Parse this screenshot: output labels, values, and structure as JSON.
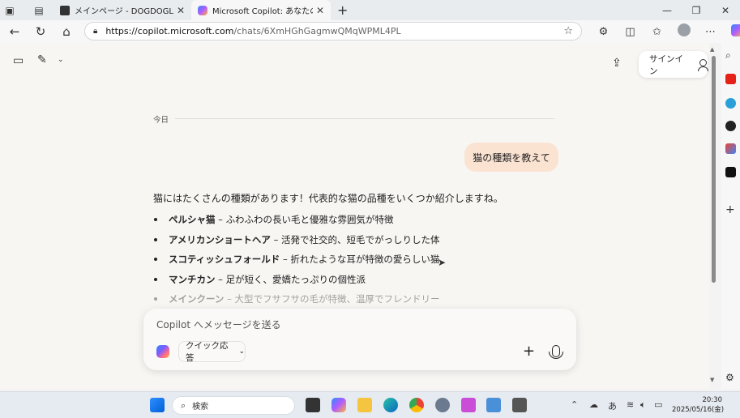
{
  "browser": {
    "tabs": [
      {
        "title": "メインページ - DOGDOGLAB",
        "active": false
      },
      {
        "title": "Microsoft Copilot: あなたの AI アシ",
        "active": true
      }
    ],
    "new_tab_symbol": "+",
    "url_host": "https://copilot.microsoft.com",
    "url_path": "/chats/6XmHGhGagmwQMqWPML4PL"
  },
  "page": {
    "signin_label": "サインイン",
    "today_label": "今日",
    "user_message": "猫の種類を教えて",
    "reply_intro": "猫にはたくさんの種類があります！代表的な猫の品種をいくつか紹介しますね。",
    "reply_items": [
      {
        "name": "ペルシャ猫",
        "sep": " – ",
        "desc": "ふわふわの長い毛と優雅な雰囲気が特徴"
      },
      {
        "name": "アメリカンショートヘア",
        "sep": " – ",
        "desc": "活発で社交的、短毛でがっしりした体"
      },
      {
        "name": "スコティッシュフォールド",
        "sep": " – ",
        "desc": "折れたような耳が特徴の愛らしい猫"
      },
      {
        "name": "マンチカン",
        "sep": " – ",
        "desc": "足が短く、愛嬌たっぷりの個性派"
      },
      {
        "name": "メインクーン",
        "sep": " – ",
        "desc": "大型でフサフサの毛が特徴、温厚でフレンドリー"
      }
    ],
    "composer_placeholder": "Copilot へメッセージを送る",
    "quick_response_label": "クイック応答"
  },
  "taskbar": {
    "search_label": "検索",
    "ime_label": "あ",
    "time": "20:30",
    "date": "2025/05/16(金)"
  },
  "colors": {
    "user_bubble": "#fbe3d2",
    "page_bg": "#f8f6f3",
    "edge_accent": "#0a66c2"
  },
  "icons": [
    "tab-actions-icon",
    "workspaces-icon",
    "back-icon",
    "refresh-icon",
    "home-icon",
    "lock-icon",
    "favorite-star-icon",
    "extensions-icon",
    "split-screen-icon",
    "favorites-icon",
    "profile-icon",
    "more-icon",
    "copilot-icon",
    "sidebar-toggle-icon",
    "new-chat-icon",
    "share-icon",
    "person-icon",
    "plus-icon",
    "microphone-icon"
  ]
}
